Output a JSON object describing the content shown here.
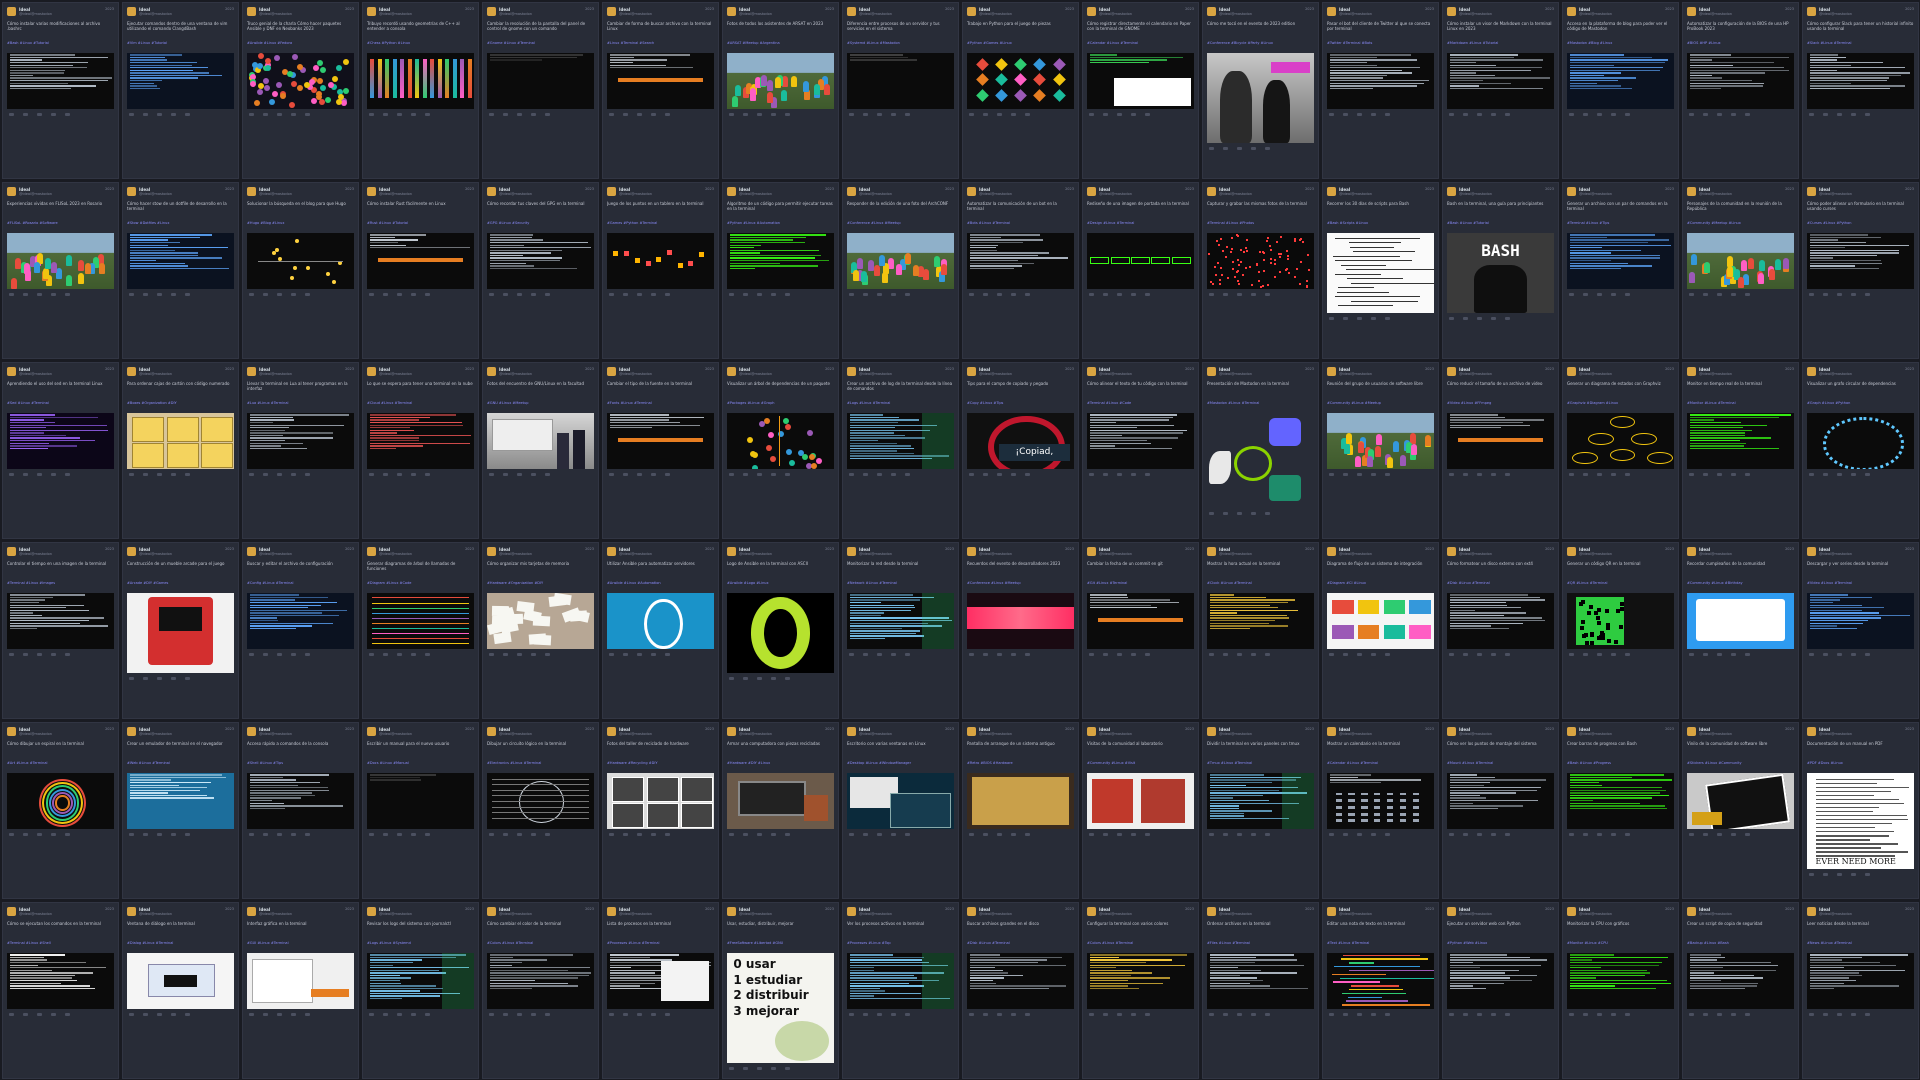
{
  "colors": {
    "background": "#191b22",
    "card": "#282c37",
    "text": "#c8ccd6",
    "hashtag": "#8c8dff",
    "terminal": "#0b0b0b",
    "terminal_green": "#39ff14"
  },
  "profile": {
    "author": "Ideal",
    "handle": "@ideal@mastodon",
    "date": "2023"
  },
  "posts": [
    {
      "text": "Cómo instalar varias modificaciones al archivo .bashrc",
      "tags": "#Bash #Linux #Tutorial",
      "media": "terminal"
    },
    {
      "text": "Ejecutar comandos dentro de una ventana de vim utilizando el comando ClangdBash",
      "tags": "#Vim #Linux #Tutorial",
      "media": "terminal-blue"
    },
    {
      "text": "Truco genial de la charla Cómo hacer paquetes Ansible y DNF en Neobanks 2023",
      "tags": "#Ansible #Linux #Fedora",
      "media": "pattern"
    },
    {
      "text": "Tribuyo recordó usando geometrías de C++ al entender a consola",
      "tags": "#Chess #Python #Linux",
      "media": "color-bars"
    },
    {
      "text": "Cambiar la resolución de la pantalla del panel de control de gnome con un comando",
      "tags": "#Gnome #Linux #Terminal",
      "media": "dark"
    },
    {
      "text": "Cambiar de forma de buscar archivo con la terminal Linux",
      "tags": "#Linux #Terminal #Search",
      "media": "terminal-strip"
    },
    {
      "text": "Fotos de todos los asistentes de ARSAT en 2023",
      "tags": "#ARSAT #Meetup #Argentina",
      "media": "photo-group"
    },
    {
      "text": "Diferencia entre procesos de un servidor y tus servicios en el sistema",
      "tags": "#Systemd #Linux #Mastodon",
      "media": "dark"
    },
    {
      "text": "Trabajo en Python para el juego de piezas",
      "tags": "#Python #Games #Linux",
      "media": "icons"
    },
    {
      "text": "Cómo registrar directamente el calendario en Paper con la terminal de GNOME",
      "tags": "#Calendar #Linux #Terminal",
      "media": "calendar"
    },
    {
      "text": "Cómo me tocó en el evento de 2023 edition",
      "tags": "#Conference #Bicycle #Party #Linux",
      "media": "photo-selfie"
    },
    {
      "text": "Pasar el bot del cliente de Twitter al que se conecta por terminal",
      "tags": "#Twitter #Terminal #Bots",
      "media": "terminal"
    },
    {
      "text": "Cómo instalar un visor de Markdown con la terminal Linux en 2023",
      "tags": "#Markdown #Linux #Tutorial",
      "media": "terminal"
    },
    {
      "text": "Acceso en la plataforma de blog para poder ver el código de Mastodon",
      "tags": "#Mastodon #Blog #Linux",
      "media": "terminal-blue"
    },
    {
      "text": "Automatizar la configuración de la BIOS de una HP ProBook 2023",
      "tags": "#BIOS #HP #Linux",
      "media": "terminal"
    },
    {
      "text": "Cómo configurar Slack para tener un historial infinito usando la terminal",
      "tags": "#Slack #Linux #Terminal",
      "media": "terminal"
    },
    {
      "text": "Experiencias vividas en FLISoL 2023 en Rosario",
      "tags": "#FLISoL #Rosario #Software",
      "media": "photo-group"
    },
    {
      "text": "Cómo hacer stow de un dotfile de desarrollo en la terminal",
      "tags": "#Stow #Dotfiles #Linux",
      "media": "terminal-blue"
    },
    {
      "text": "Solucionar la búsqueda en el blog para que Hugo",
      "tags": "#Hugo #Blog #Linux",
      "media": "graph"
    },
    {
      "text": "Cómo instalar Rust fácilmente en Linux",
      "tags": "#Rust #Linux #Tutorial",
      "media": "terminal-strip"
    },
    {
      "text": "Cómo recordar tus claves del GPG en la terminal",
      "tags": "#GPG #Linux #Security",
      "media": "terminal"
    },
    {
      "text": "Juego de los puntos en un tablero en la terminal",
      "tags": "#Games #Python #Terminal",
      "media": "arcade"
    },
    {
      "text": "Algoritmo de un código para permitir ejecutar tareas en la terminal",
      "tags": "#Python #Linux #Automation",
      "media": "terminal-green"
    },
    {
      "text": "Responder de la edición de una foto del ArchCONF",
      "tags": "#Conference #Linux #Meetup",
      "media": "photo-group"
    },
    {
      "text": "Automatizar la comunicación de un bot en la terminal",
      "tags": "#Bots #Linux #Terminal",
      "media": "terminal"
    },
    {
      "text": "Rediseño de una imagen de portada en la terminal",
      "tags": "#Design #Linux #Terminal",
      "media": "green-bars"
    },
    {
      "text": "Capturar y grabar las mismas fotos de la terminal",
      "tags": "#Terminal #Linux #Photos",
      "media": "red-dots"
    },
    {
      "text": "Recorrer los 30 días de scripts para Bash",
      "tags": "#Bash #Scripts #Linux",
      "media": "sketch"
    },
    {
      "text": "Bash en la terminal, una guía para principiantes",
      "tags": "#Bash #Linux #Tutorial",
      "media": "bash-logo"
    },
    {
      "text": "Generar un archivo con un par de comandos en la terminal",
      "tags": "#Terminal #Linux #Tips",
      "media": "terminal-blue"
    },
    {
      "text": "Personajes de la comunidad en la reunión de la República",
      "tags": "#Community #Meetup #Linux",
      "media": "photo-group"
    },
    {
      "text": "Cómo poder alinear un formulario en la terminal usando curses",
      "tags": "#Curses #Linux #Python",
      "media": "terminal"
    },
    {
      "text": "Aprendiendo el uso del sed en la terminal Linux",
      "tags": "#Sed #Linux #Terminal",
      "media": "terminal-purple"
    },
    {
      "text": "Para ordenar cajas de cartón con código numerado",
      "tags": "#Boxes #Organization #DIY",
      "media": "boxes"
    },
    {
      "text": "Llevar la terminal en Lua al tener programas en la interfaz",
      "tags": "#Lua #Linux #Terminal",
      "media": "terminal"
    },
    {
      "text": "Lo que se espera para tener una terminal en la nube",
      "tags": "#Cloud #Linux #Terminal",
      "media": "terminal-red"
    },
    {
      "text": "Fotos del encuentro de GNU/Linux en la facultad",
      "tags": "#GNU #Linux #Meetup",
      "media": "photo-room"
    },
    {
      "text": "Cambiar el tipo de la fuente en la terminal",
      "tags": "#Fonts #Linux #Terminal",
      "media": "terminal-strip"
    },
    {
      "text": "Visualizar un árbol de dependencias de un paquete",
      "tags": "#Packages #Linux #Graph",
      "media": "tree"
    },
    {
      "text": "Crear un archivo de log de la terminal desde la línea de comandos",
      "tags": "#Logs #Linux #Terminal",
      "media": "terminal-dense"
    },
    {
      "text": "Tips para el campo de copiado y pegado",
      "tags": "#Copy #Linux #Tips",
      "media": "copiad"
    },
    {
      "text": "Cómo alinear el texto de tu código con la terminal",
      "tags": "#Terminal #Linux #Code",
      "media": "terminal"
    },
    {
      "text": "Presentación de Mastodon en la terminal",
      "tags": "#Mastodon #Linux #Terminal",
      "media": "mastodon"
    },
    {
      "text": "Reunión del grupo de usuarios de software libre",
      "tags": "#Community #Linux #Meetup",
      "media": "photo-group"
    },
    {
      "text": "Cómo reducir el tamaño de un archivo de video",
      "tags": "#Video #Linux #FFmpeg",
      "media": "terminal-strip"
    },
    {
      "text": "Generar un diagrama de estados con Graphviz",
      "tags": "#Graphviz #Diagram #Linux",
      "media": "state-diagram"
    },
    {
      "text": "Monitor en tiempo real de la terminal",
      "tags": "#Monitor #Linux #Terminal",
      "media": "terminal-green"
    },
    {
      "text": "Visualizar un grafo circular de dependencias",
      "tags": "#Graph #Linux #Python",
      "media": "circle"
    },
    {
      "text": "Controlar el tiempo en una imagen de la terminal",
      "tags": "#Terminal #Linux #Images",
      "media": "terminal"
    },
    {
      "text": "Construcción de un mueble arcade para el juego",
      "tags": "#Arcade #DIY #Games",
      "media": "arcade-cabinet"
    },
    {
      "text": "Buscar y editar el archivo de configuración",
      "tags": "#Config #Linux #Terminal",
      "media": "terminal-blue"
    },
    {
      "text": "Generar diagramas de árbol de llamadas de funciones",
      "tags": "#Diagram #Linux #Code",
      "media": "wires"
    },
    {
      "text": "Cómo organizar mis tarjetas de memoria",
      "tags": "#Hardware #Organization #DIY",
      "media": "papers"
    },
    {
      "text": "Utilizar Ansible para automatizar servidores",
      "tags": "#Ansible #Linux #Automation",
      "media": "ansible-blue"
    },
    {
      "text": "Logo de Ansible en la terminal con ASCII",
      "tags": "#Ansible #Logo #Linux",
      "media": "ansible-green"
    },
    {
      "text": "Monitorizar la red desde la terminal",
      "tags": "#Network #Linux #Terminal",
      "media": "terminal-dense"
    },
    {
      "text": "Recuerdos del evento de desarrolladores 2023",
      "tags": "#Conference #Linux #Meetup",
      "media": "stage"
    },
    {
      "text": "Cambiar la fecha de un commit en git",
      "tags": "#Git #Linux #Terminal",
      "media": "terminal-strip"
    },
    {
      "text": "Mostrar la hora actual en la terminal",
      "tags": "#Clock #Linux #Terminal",
      "media": "terminal-yellow"
    },
    {
      "text": "Diagrama de flujo de un sistema de integración",
      "tags": "#Diagram #CI #Linux",
      "media": "flowchart"
    },
    {
      "text": "Cómo formatear un disco externo con ext4",
      "tags": "#Disk #Linux #Terminal",
      "media": "terminal"
    },
    {
      "text": "Generar un código QR en la terminal",
      "tags": "#QR #Linux #Terminal",
      "media": "qr"
    },
    {
      "text": "Recordar cumpleaños de la comunidad",
      "tags": "#Community #Linux #Birthday",
      "media": "tweet"
    },
    {
      "text": "Descargar y ver series desde la terminal",
      "tags": "#Video #Linux #Terminal",
      "media": "terminal-blue"
    },
    {
      "text": "Cómo dibujar un espiral en la terminal",
      "tags": "#Art #Linux #Terminal",
      "media": "spiral"
    },
    {
      "text": "Crear un emulador de terminal en el navegador",
      "tags": "#Web #Linux #Terminal",
      "media": "terminal-cyan"
    },
    {
      "text": "Acceso rápido a comandos de la consola",
      "tags": "#Shell #Linux #Tips",
      "media": "terminal"
    },
    {
      "text": "Escribir un manual para el nuevo usuario",
      "tags": "#Docs #Linux #Manual",
      "media": "dark"
    },
    {
      "text": "Dibujar un circuito lógico en la terminal",
      "tags": "#Electronics #Linux #Terminal",
      "media": "circuit"
    },
    {
      "text": "Fotos del taller de reciclado de hardware",
      "tags": "#Hardware #Recycling #DIY",
      "media": "photo-bw"
    },
    {
      "text": "Armar una computadora con piezas recicladas",
      "tags": "#Hardware #DIY #Linux",
      "media": "photo-hardware"
    },
    {
      "text": "Escritorio con varias ventanas en Linux",
      "tags": "#Desktop #Linux #WindowManager",
      "media": "desktop"
    },
    {
      "text": "Pantalla de arranque de un sistema antiguo",
      "tags": "#Retro #BIOS #Hardware",
      "media": "retro-screen"
    },
    {
      "text": "Visitas de la comunidad al laboratorio",
      "tags": "#Community #Linux #Visit",
      "media": "photo-people"
    },
    {
      "text": "Dividir la terminal en varios paneles con tmux",
      "tags": "#Tmux #Linux #Terminal",
      "media": "terminal-dense"
    },
    {
      "text": "Mostrar un calendario en la terminal",
      "tags": "#Calendar #Linux #Terminal",
      "media": "terminal-cal"
    },
    {
      "text": "Cómo ver los puntos de montaje del sistema",
      "tags": "#Mount #Linux #Terminal",
      "media": "terminal"
    },
    {
      "text": "Crear barras de progreso con Bash",
      "tags": "#Bash #Linux #Progress",
      "media": "terminal-green"
    },
    {
      "text": "Vinilo de la comunidad de software libre",
      "tags": "#Stickers #Linux #Community",
      "media": "sticker"
    },
    {
      "text": "Documentación de un manual en PDF",
      "tags": "#PDF #Docs #Linux",
      "media": "doc"
    },
    {
      "text": "Cómo se ejecutan los comandos en la terminal",
      "tags": "#Terminal #Linux #Shell",
      "media": "terminal-white"
    },
    {
      "text": "Ventana de diálogo en la terminal",
      "tags": "#Dialog #Linux #Terminal",
      "media": "dialog"
    },
    {
      "text": "Interfaz gráfica en la terminal",
      "tags": "#GUI #Linux #Terminal",
      "media": "gui"
    },
    {
      "text": "Revisar los logs del sistema con journalctl",
      "tags": "#Logs #Linux #Systemd",
      "media": "terminal-dense"
    },
    {
      "text": "Cómo cambiar el color de la terminal",
      "tags": "#Colors #Linux #Terminal",
      "media": "terminal"
    },
    {
      "text": "Lista de procesos en la terminal",
      "tags": "#Processes #Linux #Terminal",
      "media": "windows"
    },
    {
      "text": "Usar, estudiar, distribuir, mejorar",
      "tags": "#FreeSoftware #Libertad #GNU",
      "media": "poster"
    },
    {
      "text": "Ver los procesos activos en la terminal",
      "tags": "#Processes #Linux #Top",
      "media": "terminal-dense"
    },
    {
      "text": "Buscar archivos grandes en el disco",
      "tags": "#Disk #Linux #Terminal",
      "media": "terminal"
    },
    {
      "text": "Configurar la terminal con varios colores",
      "tags": "#Colors #Linux #Terminal",
      "media": "terminal-yellow"
    },
    {
      "text": "Ordenar archivos en la terminal",
      "tags": "#Files #Linux #Terminal",
      "media": "terminal"
    },
    {
      "text": "Editar una nota de texto en la terminal",
      "tags": "#Text #Linux #Terminal",
      "media": "terminal-color"
    },
    {
      "text": "Ejecutar un servidor web con Python",
      "tags": "#Python #Web #Linux",
      "media": "terminal"
    },
    {
      "text": "Monitorizar la CPU con gráficos",
      "tags": "#Monitor #Linux #CPU",
      "media": "terminal-green"
    },
    {
      "text": "Crear un script de copia de seguridad",
      "tags": "#Backup #Linux #Bash",
      "media": "terminal"
    },
    {
      "text": "Leer noticias desde la terminal",
      "tags": "#News #Linux #Terminal",
      "media": "terminal"
    }
  ],
  "poster_words": [
    "usar",
    "estudiar",
    "distribuir",
    "mejorar"
  ],
  "copiad_text": "¡Copiad, malditos!",
  "bash_text": "BASH",
  "doc_footer_text": "EVER NEED MORE"
}
